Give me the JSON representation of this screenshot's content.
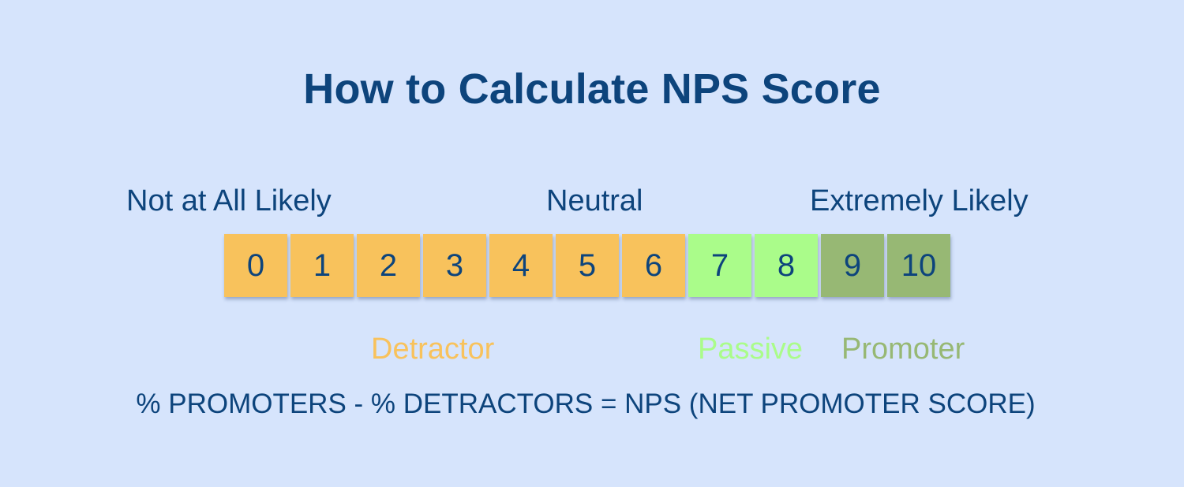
{
  "title": "How to Calculate NPS Score",
  "scale_labels": {
    "low": "Not at All Likely",
    "mid": "Neutral",
    "high": "Extremely Likely"
  },
  "colors": {
    "detractor": "#f8c25c",
    "passive": "#aafc8a",
    "promoter": "#97b874",
    "text": "#0d447c",
    "background": "#d6e4fc"
  },
  "scores": [
    {
      "value": "0",
      "category": "detractor"
    },
    {
      "value": "1",
      "category": "detractor"
    },
    {
      "value": "2",
      "category": "detractor"
    },
    {
      "value": "3",
      "category": "detractor"
    },
    {
      "value": "4",
      "category": "detractor"
    },
    {
      "value": "5",
      "category": "detractor"
    },
    {
      "value": "6",
      "category": "detractor"
    },
    {
      "value": "7",
      "category": "passive"
    },
    {
      "value": "8",
      "category": "passive"
    },
    {
      "value": "9",
      "category": "promoter"
    },
    {
      "value": "10",
      "category": "promoter"
    }
  ],
  "categories": {
    "detractor": "Detractor",
    "passive": "Passive",
    "promoter": "Promoter"
  },
  "formula": "% PROMOTERS - % DETRACTORS = NPS (NET PROMOTER SCORE)"
}
